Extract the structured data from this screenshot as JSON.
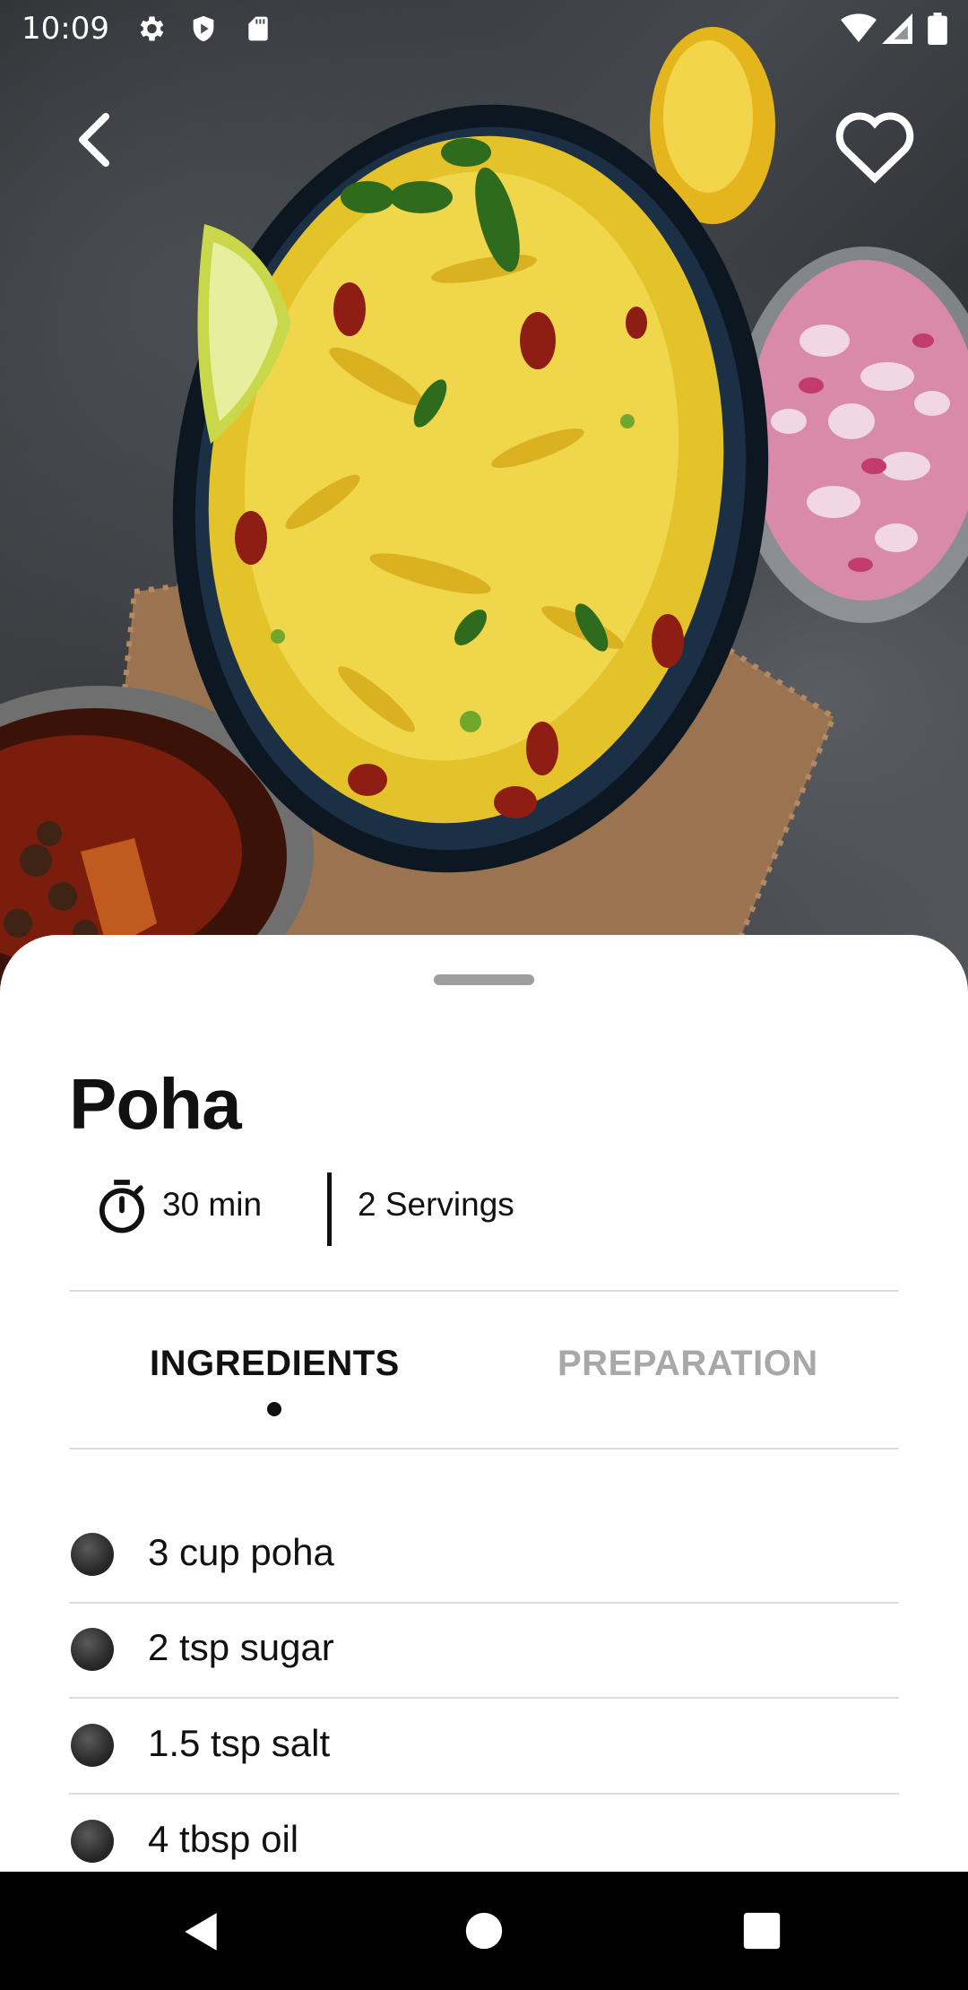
{
  "status_bar": {
    "time": "10:09",
    "icons": [
      "gear-icon",
      "shield-icon",
      "sd-card-icon",
      "wifi-icon",
      "signal-icon",
      "battery-icon"
    ]
  },
  "header": {
    "back_icon": "chevron-left-icon",
    "favorite_icon": "heart-outline-icon"
  },
  "recipe": {
    "title": "Poha",
    "time": "30 min",
    "servings": "2 Servings"
  },
  "tabs": [
    {
      "label": "INGREDIENTS",
      "active": true
    },
    {
      "label": "PREPARATION",
      "active": false
    }
  ],
  "ingredients": [
    {
      "text": "3 cup poha"
    },
    {
      "text": "2 tsp sugar"
    },
    {
      "text": "1.5 tsp salt"
    },
    {
      "text": "4 tbsp oil"
    }
  ],
  "nav_bar": {
    "icons": [
      "back-triangle-icon",
      "home-circle-icon",
      "recents-square-icon"
    ]
  },
  "colors": {
    "text_primary": "#111111",
    "tab_inactive": "#a8a8a8",
    "divider": "#dcdcdc",
    "sheet": "#ffffff"
  }
}
